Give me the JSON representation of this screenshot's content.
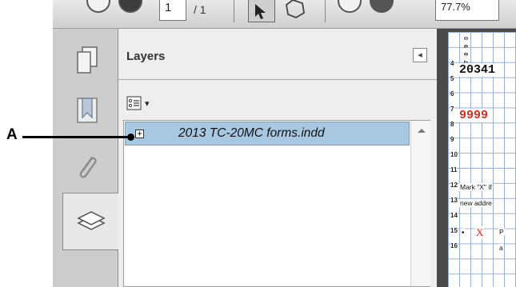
{
  "toolbar": {
    "page_number": "1",
    "page_total": "/ 1",
    "zoom": "77.7%"
  },
  "nav": {
    "items": [
      {
        "name": "pages",
        "icon": "pages-icon"
      },
      {
        "name": "bookmarks",
        "icon": "bookmark-icon"
      },
      {
        "name": "attachments",
        "icon": "paperclip-icon"
      },
      {
        "name": "layers",
        "icon": "layers-icon",
        "active": true
      }
    ]
  },
  "layers_panel": {
    "title": "Layers",
    "collapse_glyph": "◂",
    "options_glyph": "▾",
    "layers": [
      {
        "name": "2013 TC-20MC forms.indd",
        "expander": "+",
        "selected": true
      }
    ]
  },
  "document": {
    "row_numbers": [
      "4",
      "5",
      "6",
      "7",
      "8",
      "9",
      "10",
      "11",
      "12",
      "13",
      "14",
      "15",
      "16"
    ],
    "column_header": "6 7 8 9 0",
    "value_black": "20341",
    "value_red": "9999",
    "mark_text": "Mark \"X\" if",
    "address_text": "new addre",
    "x_mark": "X",
    "bullet": "•",
    "letter_p": "P",
    "letter_a": "a"
  },
  "callout": {
    "label": "A"
  },
  "colors": {
    "selection": "#a8c8e2",
    "doc_red": "#e0281e",
    "grid_blue": "#9ab0d8"
  }
}
